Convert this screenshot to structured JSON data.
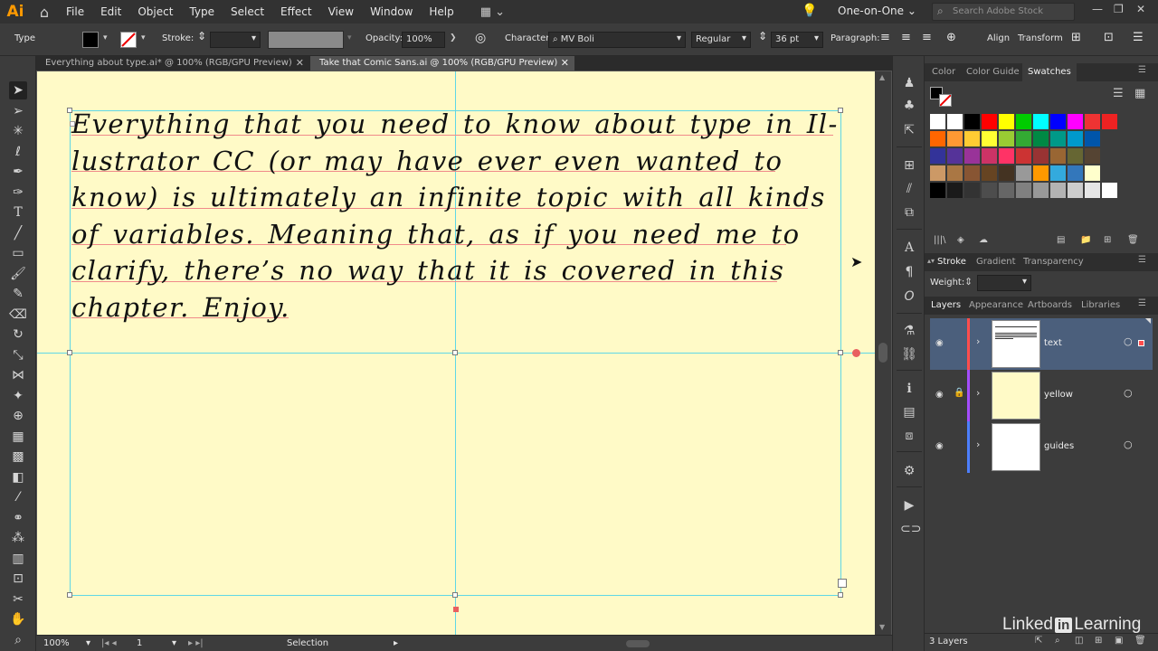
{
  "app": {
    "logo": "Ai"
  },
  "menus": [
    "File",
    "Edit",
    "Object",
    "Type",
    "Select",
    "Effect",
    "View",
    "Window",
    "Help"
  ],
  "workspace": "One-on-One",
  "stock_search_placeholder": "Search Adobe Stock",
  "control": {
    "mode": "Type",
    "stroke_label": "Stroke:",
    "opacity_label": "Opacity:",
    "opacity_value": "100%",
    "character_label": "Character:",
    "font_family": "MV Boli",
    "font_style": "Regular",
    "font_size": "36 pt",
    "paragraph_label": "Paragraph:",
    "align_label": "Align",
    "transform_label": "Transform"
  },
  "tabs": [
    {
      "label": "Everything about type.ai* @ 100% (RGB/GPU Preview)",
      "active": false
    },
    {
      "label": "Take that Comic Sans.ai @ 100% (RGB/GPU Preview)",
      "active": true
    }
  ],
  "document": {
    "lines": [
      "Everything that you need to know about type in Il-",
      "lustrator CC (or may have ever even wanted to",
      "know) is ultimately an infinite topic with all kinds",
      "of variables. Meaning that, as if you need me to",
      "clarify, there’s no way that it is covered in this",
      "chapter. Enjoy."
    ],
    "canvas_color": "#fffac7"
  },
  "status": {
    "zoom": "100%",
    "artboard": "1",
    "tool": "Selection"
  },
  "swatch_panel": {
    "tabs": [
      "Color",
      "Color Guide",
      "Swatches"
    ],
    "active": "Swatches"
  },
  "swatch_colors": [
    [
      "#ffffff",
      "#ffffff",
      "#000000",
      "#ff0000",
      "#ffff00",
      "#00cc00",
      "#00ffff",
      "#0000ff",
      "#ff00ff",
      "#ee3333",
      "#ee2222"
    ],
    [
      "#ff6600",
      "#ff9933",
      "#ffcc33",
      "#ffff33",
      "#99cc33",
      "#33aa33",
      "#008844",
      "#009988",
      "#0099cc",
      "#0055aa"
    ],
    [
      "#333399",
      "#553399",
      "#993399",
      "#cc3366",
      "#ff3366",
      "#cc3333",
      "#993333",
      "#996633",
      "#666633",
      "#554433"
    ],
    [
      "#cc9966",
      "#aa7744",
      "#885533",
      "#664422",
      "#443322",
      "#999999",
      "#ff9900",
      "#33aadd",
      "#3377bb",
      "#ffffcc"
    ],
    [
      "#000000",
      "#1a1a1a",
      "#333333",
      "#4d4d4d",
      "#666666",
      "#808080",
      "#999999",
      "#b3b3b3",
      "#cccccc",
      "#e6e6e6",
      "#ffffff"
    ]
  ],
  "stroke_panel": {
    "tabs": [
      "Stroke",
      "Gradient",
      "Transparency"
    ],
    "active": "Stroke",
    "weight_label": "Weight:"
  },
  "layers_panel": {
    "tabs": [
      "Layers",
      "Appearance",
      "Artboards",
      "Libraries"
    ],
    "active": "Layers",
    "layers": [
      {
        "name": "text",
        "color": "#ff4d4d",
        "selected": true,
        "locked": false
      },
      {
        "name": "yellow",
        "color": "#a54dff",
        "selected": false,
        "locked": true
      },
      {
        "name": "guides",
        "color": "#4d7fff",
        "selected": false,
        "locked": false
      }
    ],
    "count": "3 Layers"
  },
  "watermark": {
    "pre": "Linked",
    "in": "in",
    "post": "Learning"
  }
}
